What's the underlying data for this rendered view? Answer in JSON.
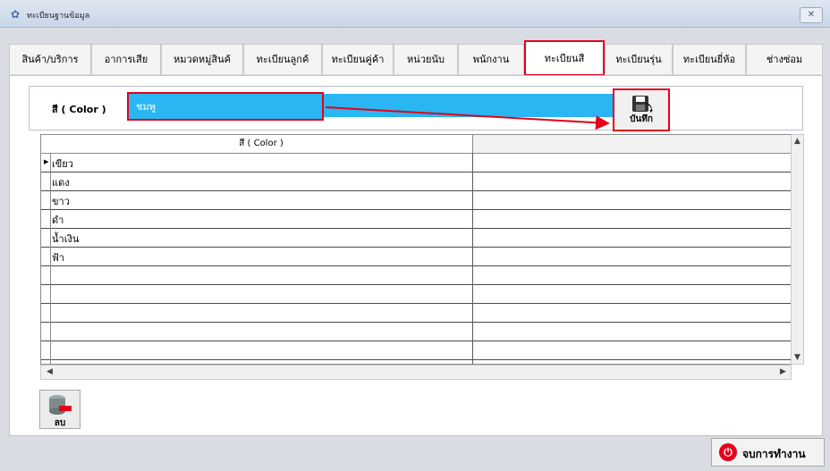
{
  "window": {
    "title": "ทะเบียนฐานข้อมูล",
    "close_label": "✕",
    "icon": "app-icon"
  },
  "tabs": [
    {
      "label": "สินค้า/บริการ"
    },
    {
      "label": "อาการเสีย"
    },
    {
      "label": "หมวดหมู่สินค้"
    },
    {
      "label": "ทะเบียนลูกค้"
    },
    {
      "label": "ทะเบียนคู่ค้า"
    },
    {
      "label": "หน่วยนับ"
    },
    {
      "label": "พนักงาน"
    },
    {
      "label": "ทะเบียนสี",
      "active": true
    },
    {
      "label": "ทะเบียนรุ่น"
    },
    {
      "label": "ทะเบียนยี่ห้อ"
    },
    {
      "label": "ช่างซ่อม"
    }
  ],
  "form": {
    "label": "สี ( Color )",
    "input_value": "ชมพู",
    "save_label": "บันทึก"
  },
  "grid": {
    "header": "สี ( Color )",
    "rows": [
      "เขียว",
      "แดง",
      "ขาว",
      "ดำ",
      "น้ำเงิน",
      "ฟ้า",
      "",
      "",
      "",
      "",
      ""
    ]
  },
  "actions": {
    "delete_label": "ลบ",
    "exit_label": "จบการทำงาน"
  },
  "colors": {
    "accent": "#e3001b",
    "input_bg": "#29b6f2"
  }
}
